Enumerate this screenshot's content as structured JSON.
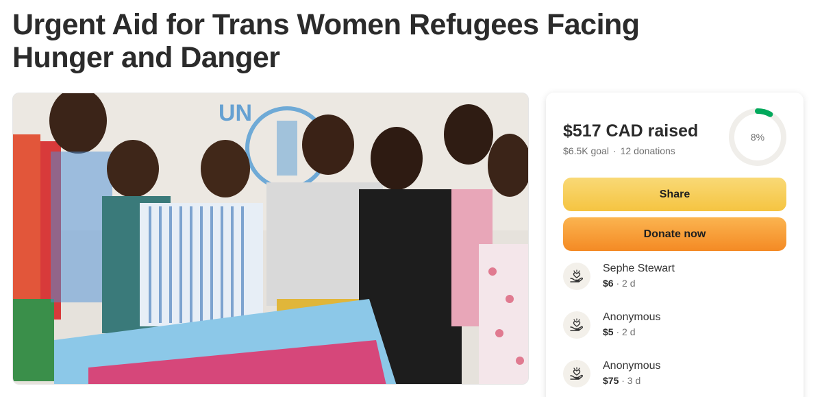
{
  "campaign": {
    "title": "Urgent Aid for Trans Women Refugees Facing Hunger and Danger",
    "image_alt": "Group of trans women refugees standing in front of a UNHCR tarp holding a flag"
  },
  "summary": {
    "raised": "$517 CAD raised",
    "goal": "$6.5K goal",
    "separator": "·",
    "donations": "12 donations",
    "progress_label": "8%",
    "progress_fraction": 0.08,
    "progress_color": "#02a95c"
  },
  "buttons": {
    "share": "Share",
    "donate": "Donate now"
  },
  "donations": [
    {
      "name": "Sephe Stewart",
      "amount": "$6",
      "time": "· 2 d"
    },
    {
      "name": "Anonymous",
      "amount": "$5",
      "time": "· 2 d"
    },
    {
      "name": "Anonymous",
      "amount": "$75",
      "time": "· 3 d"
    }
  ]
}
